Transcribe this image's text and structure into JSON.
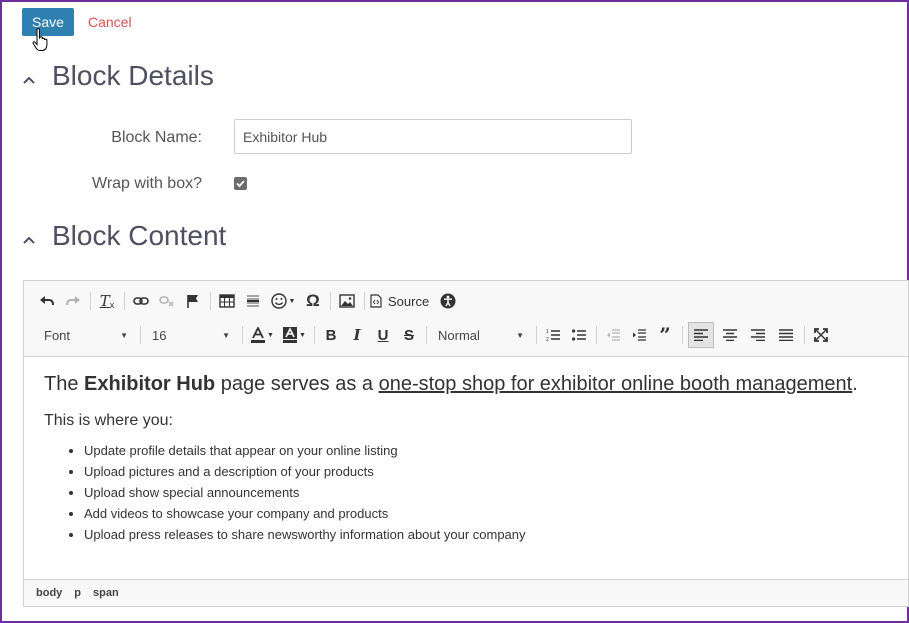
{
  "actions": {
    "save_label": "Save",
    "cancel_label": "Cancel"
  },
  "sections": {
    "details_title": "Block Details",
    "content_title": "Block Content"
  },
  "form": {
    "block_name_label": "Block Name:",
    "block_name_value": "Exhibitor Hub",
    "wrap_label": "Wrap with box?",
    "wrap_checked": true
  },
  "toolbar": {
    "source_label": "Source",
    "font_label": "Font",
    "size_label": "16",
    "format_label": "Normal",
    "icons_row1": [
      "undo-icon",
      "redo-icon",
      "remove-format-icon",
      "link-icon",
      "unlink-icon",
      "anchor-flag-icon",
      "table-icon",
      "horizontal-rule-icon",
      "emoji-icon",
      "special-char-omega-icon",
      "image-icon",
      "source-icon",
      "accessibility-icon"
    ],
    "icons_row2": [
      "text-color-icon",
      "background-color-icon",
      "bold-icon",
      "italic-icon",
      "underline-icon",
      "strikethrough-icon",
      "numbered-list-icon",
      "bulleted-list-icon",
      "outdent-icon",
      "indent-icon",
      "blockquote-icon",
      "align-left-icon",
      "align-center-icon",
      "align-right-icon",
      "justify-icon",
      "maximize-icon"
    ]
  },
  "content": {
    "lead_pre": "The ",
    "lead_bold": "Exhibitor Hub",
    "lead_mid": " page serves as a ",
    "lead_link": "one-stop shop for exhibitor online booth management",
    "lead_post": ".",
    "sub": "This is where you:",
    "items": [
      "Update profile details that appear on your online listing",
      "Upload pictures and a description of your products",
      "Upload show special announcements",
      "Add videos to showcase your company and products",
      "Upload press releases to share newsworthy information about your company"
    ]
  },
  "statusbar": {
    "path": [
      "body",
      "p",
      "span"
    ]
  },
  "colors": {
    "save_bg": "#2f7fb1",
    "cancel": "#d9534f",
    "frame": "#6b2fa0"
  }
}
